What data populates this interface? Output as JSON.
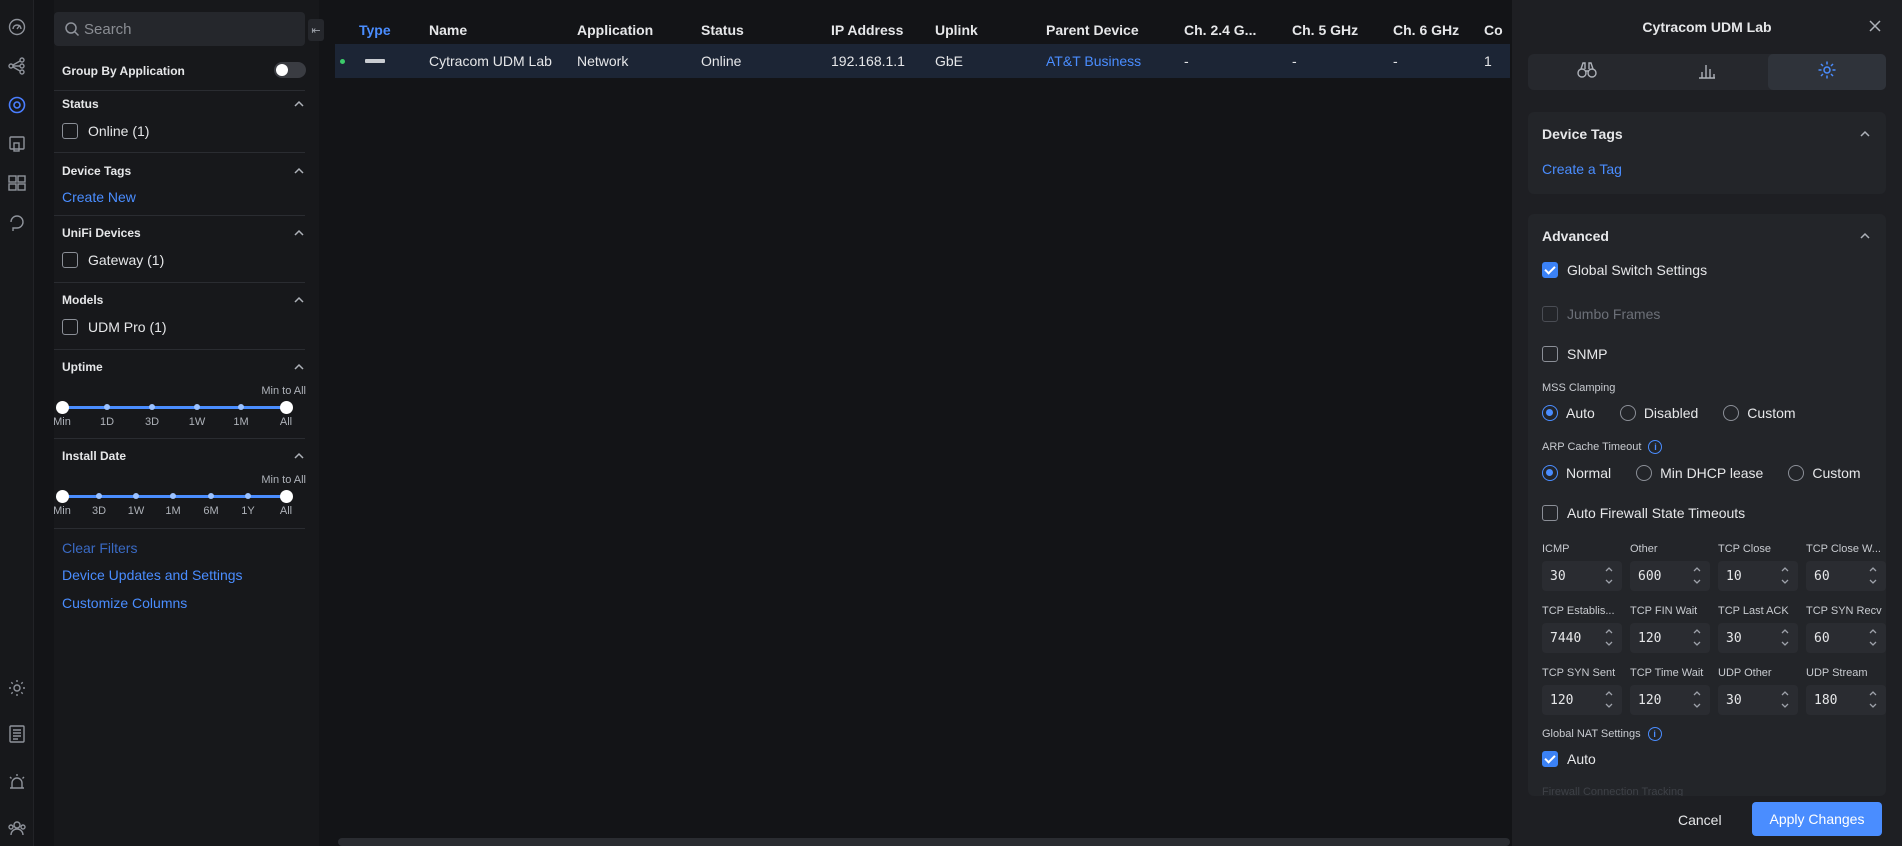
{
  "nav": {
    "icons": [
      "dashboard-icon",
      "topology-icon",
      "devices-icon",
      "client-devices-icon",
      "ports-icon",
      "insights-icon",
      "settings-icon",
      "logs-icon",
      "alarms-icon",
      "admins-icon"
    ]
  },
  "filters": {
    "search_placeholder": "Search",
    "group_by_label": "Group By Application",
    "status": {
      "title": "Status",
      "items": [
        "Online (1)"
      ]
    },
    "device_tags": {
      "title": "Device Tags",
      "link": "Create New"
    },
    "unifi_devices": {
      "title": "UniFi Devices",
      "items": [
        "Gateway (1)"
      ]
    },
    "models": {
      "title": "Models",
      "items": [
        "UDM Pro (1)"
      ]
    },
    "uptime": {
      "title": "Uptime",
      "range_label": "Min to All",
      "ticks": [
        "Min",
        "1D",
        "3D",
        "1W",
        "1M",
        "All"
      ]
    },
    "install_date": {
      "title": "Install Date",
      "range_label": "Min to All",
      "ticks": [
        "Min",
        "3D",
        "1W",
        "1M",
        "6M",
        "1Y",
        "All"
      ]
    },
    "links": {
      "clear": "Clear Filters",
      "updates": "Device Updates and Settings",
      "columns": "Customize Columns"
    }
  },
  "table": {
    "columns": [
      "Type",
      "Name",
      "Application",
      "Status",
      "IP Address",
      "Uplink",
      "Parent Device",
      "Ch. 2.4 G...",
      "Ch. 5 GHz",
      "Ch. 6 GHz",
      "Co"
    ],
    "rows": [
      {
        "name": "Cytracom UDM Lab",
        "application": "Network",
        "status": "Online",
        "ip": "192.168.1.1",
        "uplink": "GbE",
        "parent": "AT&T Business",
        "ch24": "-",
        "ch5": "-",
        "ch6": "-",
        "co": "1"
      }
    ]
  },
  "panel": {
    "title": "Cytracom UDM Lab",
    "tabs": [
      "binoculars-icon",
      "stats-icon",
      "gear-icon"
    ],
    "device_tags": {
      "title": "Device Tags",
      "link": "Create a Tag"
    },
    "advanced": {
      "title": "Advanced",
      "global_switch": "Global Switch Settings",
      "jumbo": "Jumbo Frames",
      "snmp": "SNMP",
      "mss": {
        "label": "MSS Clamping",
        "options": [
          "Auto",
          "Disabled",
          "Custom"
        ],
        "selected": "Auto"
      },
      "arp": {
        "label": "ARP Cache Timeout",
        "options": [
          "Normal",
          "Min DHCP lease",
          "Custom"
        ],
        "selected": "Normal"
      },
      "auto_fw": "Auto Firewall State Timeouts",
      "timeouts": [
        {
          "label": "ICMP",
          "value": "30"
        },
        {
          "label": "Other",
          "value": "600"
        },
        {
          "label": "TCP Close",
          "value": "10"
        },
        {
          "label": "TCP Close W...",
          "value": "60"
        },
        {
          "label": "TCP Establis...",
          "value": "7440"
        },
        {
          "label": "TCP FIN Wait",
          "value": "120"
        },
        {
          "label": "TCP Last ACK",
          "value": "30"
        },
        {
          "label": "TCP SYN Recv",
          "value": "60"
        },
        {
          "label": "TCP SYN Sent",
          "value": "120"
        },
        {
          "label": "TCP Time Wait",
          "value": "120"
        },
        {
          "label": "UDP Other",
          "value": "30"
        },
        {
          "label": "UDP Stream",
          "value": "180"
        }
      ],
      "nat": {
        "label": "Global NAT Settings",
        "auto": "Auto"
      },
      "fw_tracking": "Firewall Connection Tracking"
    },
    "cancel": "Cancel",
    "apply": "Apply Changes"
  },
  "colors": {
    "accent": "#4a8dff",
    "online": "#3ccb6a",
    "bg": "#131417",
    "panel": "#1e1f23"
  }
}
